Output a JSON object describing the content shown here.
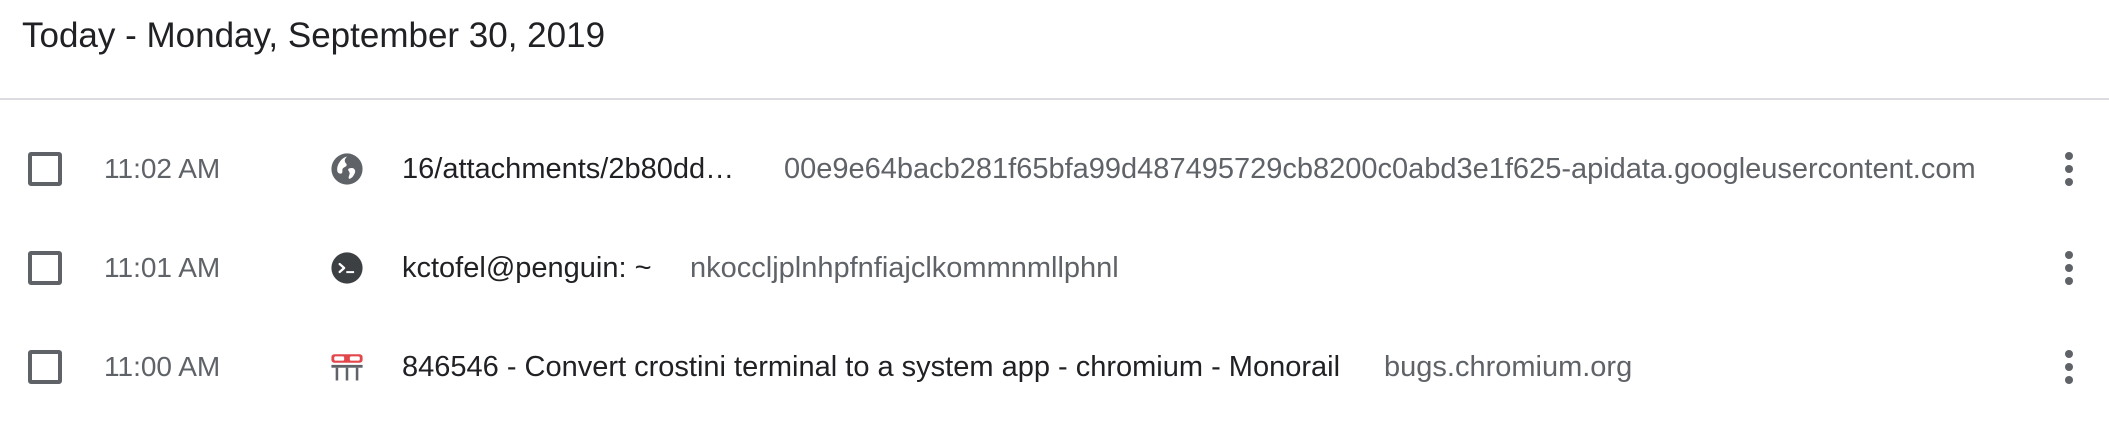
{
  "header": {
    "title": "Today - Monday, September 30, 2019"
  },
  "entries": [
    {
      "time": "11:02 AM",
      "icon": "globe-icon",
      "title": "16/attachments/2b80dd…",
      "domain": "00e9e64bacb281f65bfa99d487495729cb8200c0abd3e1f625-apidata.googleusercontent.com"
    },
    {
      "time": "11:01 AM",
      "icon": "terminal-icon",
      "title": "kctofel@penguin: ~",
      "domain": "nkoccljplnhpfnfiajclkommnmllphnl"
    },
    {
      "time": "11:00 AM",
      "icon": "monorail-icon",
      "title": "846546 - Convert crostini terminal to a system app - chromium - Monorail",
      "domain": "bugs.chromium.org"
    }
  ],
  "colors": {
    "text_primary": "#202124",
    "text_secondary": "#5f6368",
    "divider": "#dadce0",
    "monorail_red": "#e2474b"
  }
}
